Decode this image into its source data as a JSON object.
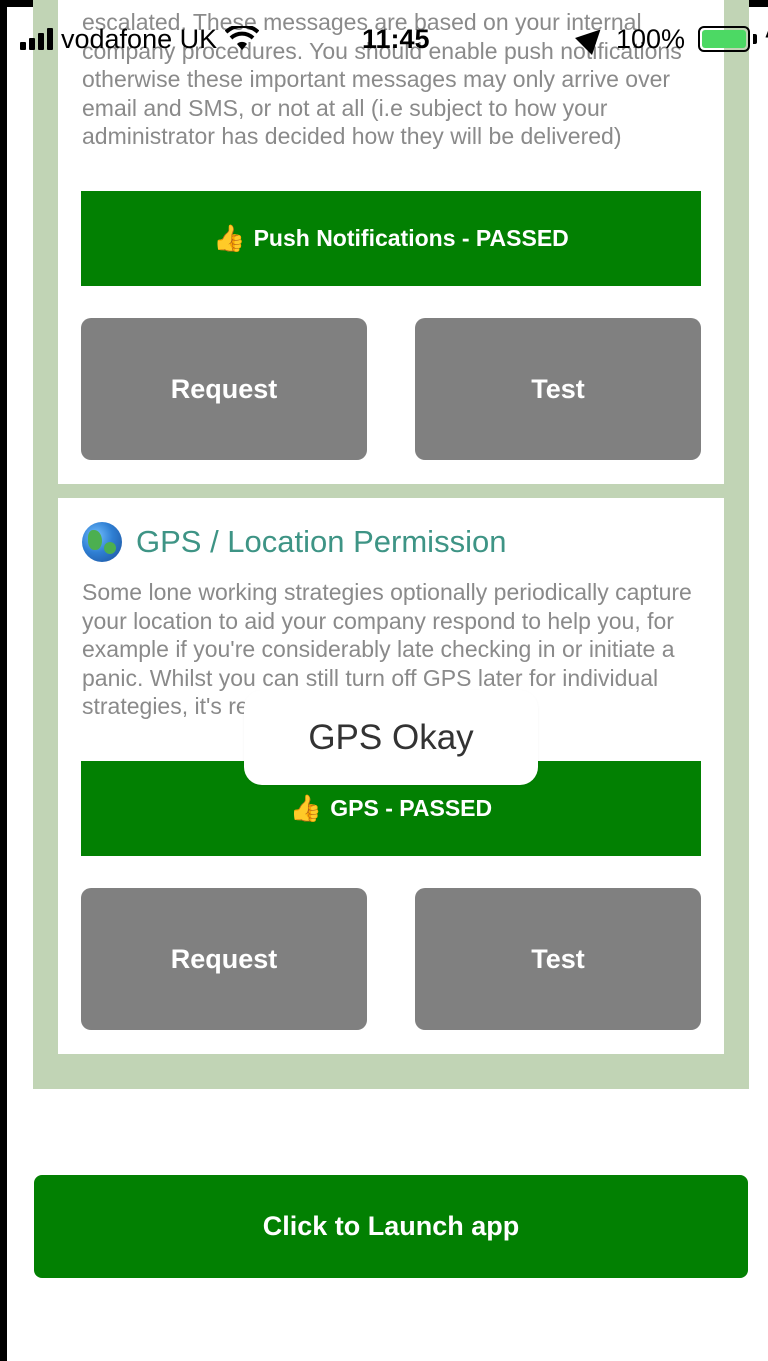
{
  "status_bar": {
    "carrier": "vodafone UK",
    "time": "11:45",
    "battery_percent": "100%",
    "battery_color": "#4cd964"
  },
  "push_card": {
    "description": "escalated. These messages are based on your internal company procedures. You should enable push notifications otherwise these important messages may only arrive over email and SMS, or not at all (i.e subject to how your administrator has decided how they will be delivered)",
    "status_icon": "thumbs-up-icon",
    "status_label": "Push Notifications - PASSED",
    "request_label": "Request",
    "test_label": "Test"
  },
  "gps_card": {
    "icon": "globe-icon",
    "title": "GPS / Location Permission",
    "description": "Some lone working strategies optionally periodically capture your location to aid your company respond to help you, for example if you're considerably late checking in or initiate a panic. Whilst you can still turn off GPS later for individual strategies, it's recommended",
    "status_icon": "thumbs-up-icon",
    "status_label": "GPS - PASSED",
    "request_label": "Request",
    "test_label": "Test"
  },
  "toast": {
    "message": "GPS Okay"
  },
  "launch_button": {
    "label": "Click to Launch app"
  },
  "colors": {
    "passed_green": "#028002",
    "panel_bg": "#c1d4b5",
    "button_grey": "#808080",
    "heading_teal": "#3e9485"
  }
}
